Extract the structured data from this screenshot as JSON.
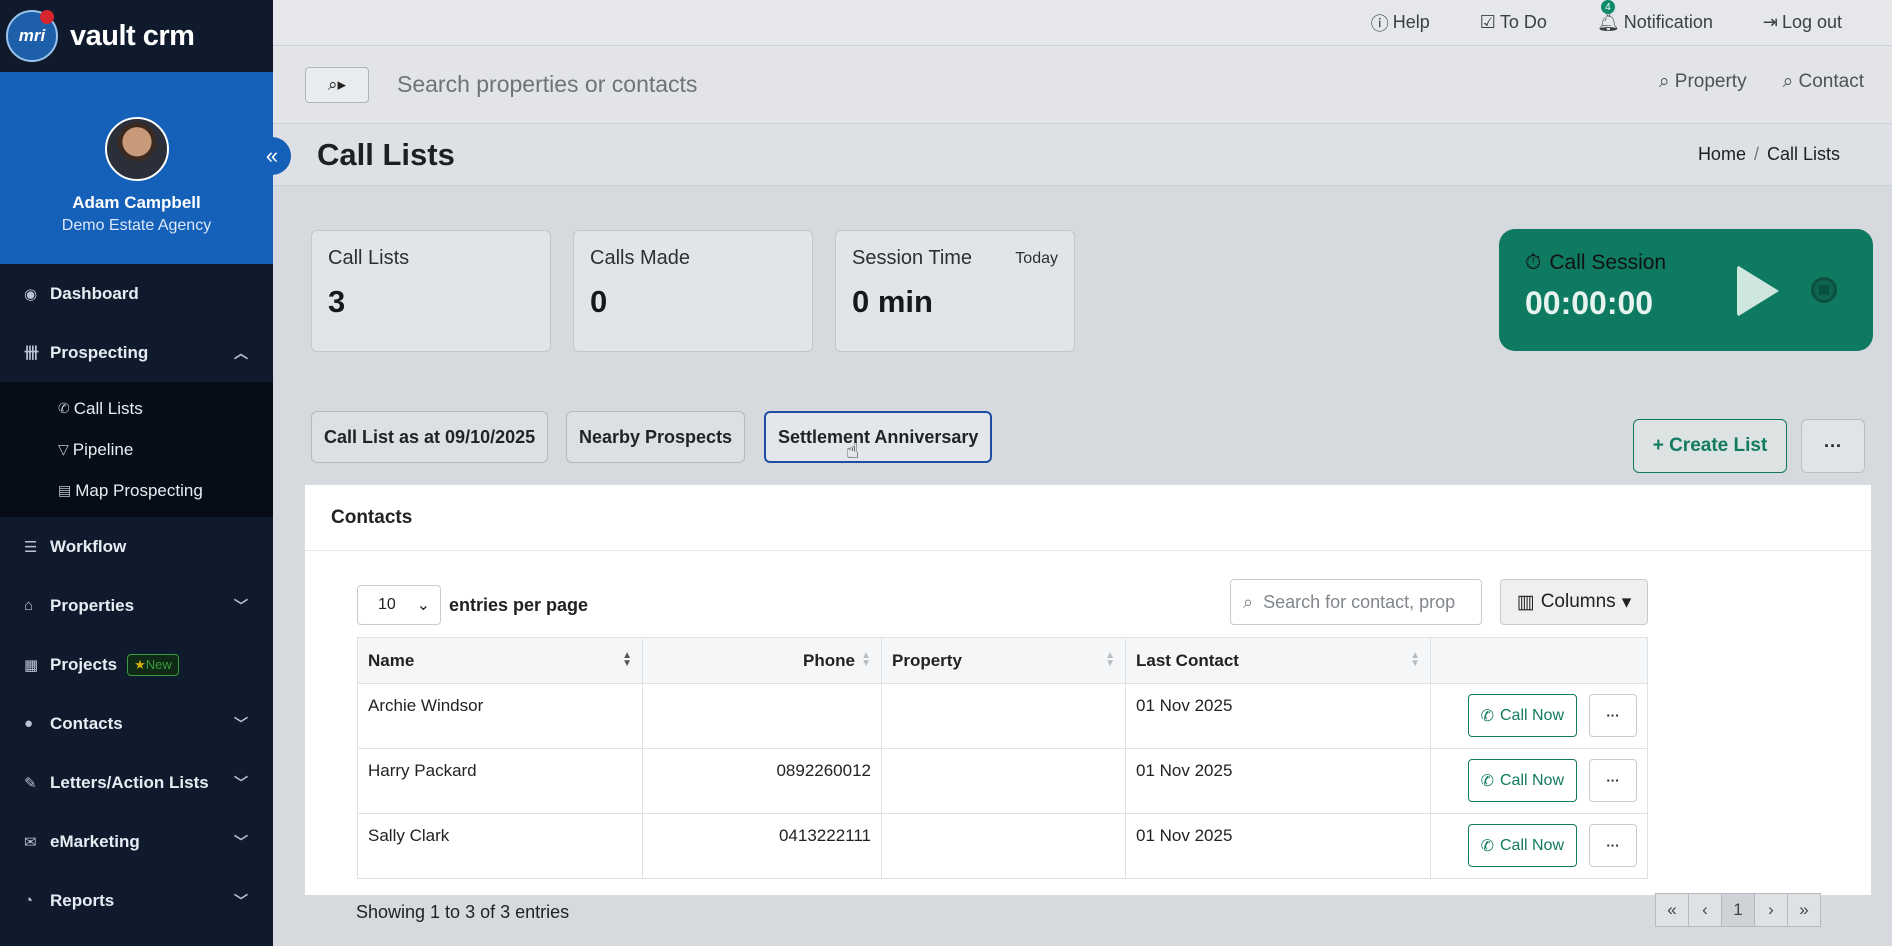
{
  "brand": {
    "name": "vault crm",
    "logo_text": "mri"
  },
  "profile": {
    "name": "Adam Campbell",
    "agency": "Demo Estate Agency"
  },
  "sidebar": {
    "items": [
      {
        "label": "Dashboard"
      },
      {
        "label": "Prospecting"
      },
      {
        "label": "Workflow"
      },
      {
        "label": "Properties"
      },
      {
        "label": "Projects",
        "badge": "New"
      },
      {
        "label": "Contacts"
      },
      {
        "label": "Letters/Action Lists"
      },
      {
        "label": "eMarketing"
      },
      {
        "label": "Reports"
      }
    ],
    "subitems": [
      {
        "label": "Call Lists"
      },
      {
        "label": "Pipeline"
      },
      {
        "label": "Map Prospecting"
      }
    ]
  },
  "topbar": {
    "help": "Help",
    "todo": "To Do",
    "notification": "Notification",
    "notification_count": "4",
    "logout": "Log out"
  },
  "search": {
    "placeholder": "Search properties or contacts",
    "scope_property": "Property",
    "scope_contact": "Contact"
  },
  "page": {
    "title": "Call Lists",
    "breadcrumb": [
      "Home",
      "Call Lists"
    ]
  },
  "stats": [
    {
      "label": "Call Lists",
      "value": "3"
    },
    {
      "label": "Calls Made",
      "value": "0"
    },
    {
      "label": "Session Time",
      "value": "0 min",
      "extra": "Today"
    }
  ],
  "session": {
    "label": "Call Session",
    "time": "00:00:00"
  },
  "lists": {
    "tabs": [
      "Call List as at 09/10/2025",
      "Nearby Prospects",
      "Settlement Anniversary"
    ],
    "active_tab": "Settlement Anniversary",
    "create_label": "+ Create List",
    "more_label": "···"
  },
  "contacts": {
    "title": "Contacts",
    "entries_value": "10",
    "entries_label": "entries per page",
    "search_placeholder": "Search for contact, prop",
    "columns_label": "Columns",
    "headers": [
      "Name",
      "Phone",
      "Property",
      "Last Contact"
    ],
    "rows": [
      {
        "name": "Archie Windsor",
        "phone": "",
        "property": "",
        "last_contact": "01 Nov 2025"
      },
      {
        "name": "Harry Packard",
        "phone": "0892260012",
        "property": "",
        "last_contact": "01 Nov 2025"
      },
      {
        "name": "Sally Clark",
        "phone": "0413222111",
        "property": "",
        "last_contact": "01 Nov 2025"
      }
    ],
    "call_label": "Call Now",
    "showing": "Showing 1 to 3 of 3 entries",
    "pager": [
      "«",
      "‹",
      "1",
      "›",
      "»"
    ]
  },
  "colors": {
    "sidebar": "#0f1b2d",
    "profile": "#1560b8",
    "accent": "#127a60",
    "session": "#0f7a62"
  }
}
